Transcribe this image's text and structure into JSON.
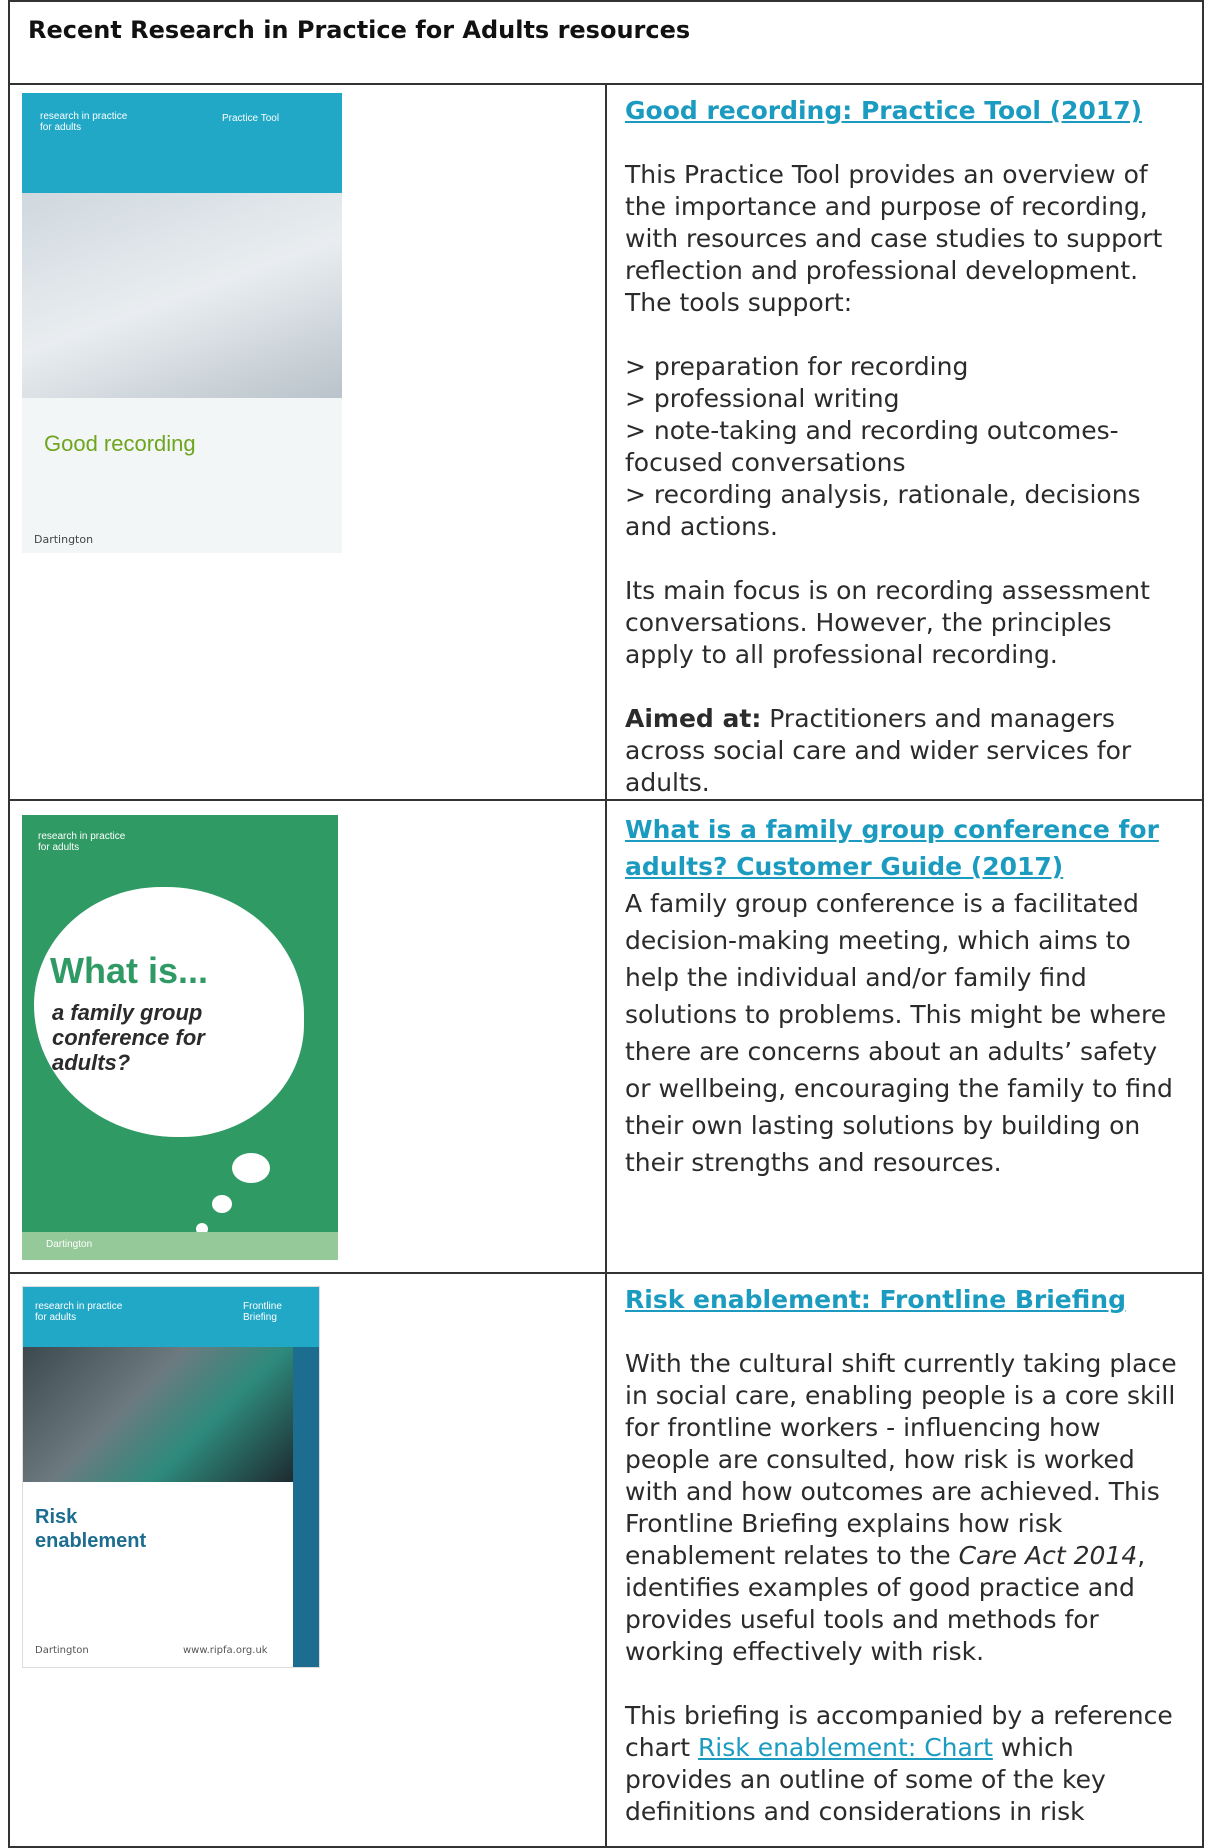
{
  "heading": "Recent Research in Practice for Adults resources",
  "resources": [
    {
      "title": "Good recording: Practice Tool (2017)",
      "cover": {
        "band_text": "research in practice for adults",
        "badge": "Practice Tool",
        "title": "Good recording",
        "footer": "Dartington"
      },
      "intro": "This Practice Tool provides an overview of the importance and purpose of recording, with resources and case studies to support reflection and professional development. The tools support:",
      "bullets": [
        "> preparation for recording",
        "> professional writing",
        "> note-taking and recording outcomes-focused conversations",
        "> recording analysis, rationale, decisions and actions."
      ],
      "focus": "Its main focus is on recording assessment conversations. However, the principles apply to all professional recording.",
      "aimed_label": "Aimed at:",
      "aimed_text": " Practitioners and managers across social care and wider services for adults."
    },
    {
      "title": "What is a family group conference for adults? Customer Guide (2017)",
      "cover": {
        "band_text": "research in practice for adults",
        "line1": "What is...",
        "line2": "a family group conference for adults?",
        "footer": "Dartington"
      },
      "body": "A family group conference is a facilitated decision-making meeting, which aims to help the individual and/or family find solutions to problems. This might be where there are concerns about an adults’ safety or wellbeing, encouraging the family to find their own lasting solutions by building on their strengths and resources."
    },
    {
      "title": "Risk enablement: Frontline Briefing",
      "cover": {
        "band_text": "research in practice for adults",
        "badge": "Frontline Briefing",
        "title": "Risk enablement",
        "footer": "Dartington",
        "url": "www.ripfa.org.uk"
      },
      "body_a": "With the cultural shift currently taking place in social care, enabling people is a core skill for frontline workers - influencing how people are consulted, how risk is worked with and how outcomes are achieved. This Frontline Briefing explains how risk enablement relates to the ",
      "body_italic": "Care Act 2014",
      "body_b": ", identifies examples of good practice and provides useful tools and methods for working effectively with risk.",
      "chart_a": "This briefing is accompanied by a reference chart ",
      "chart_link": "Risk enablement: Chart",
      "chart_b": " which provides an outline of some of the key definitions and considerations in risk"
    }
  ]
}
